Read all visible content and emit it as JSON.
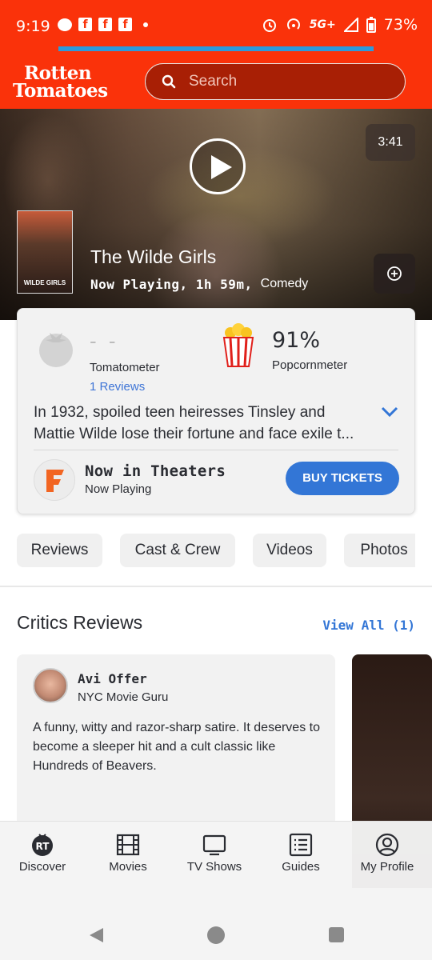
{
  "status": {
    "time": "9:19",
    "network": "5G+",
    "battery": "73%"
  },
  "header": {
    "logo_line1": "Rotten",
    "logo_line2": "Tomatoes",
    "search_placeholder": "Search"
  },
  "hero": {
    "duration": "3:41",
    "title": "The Wilde Girls",
    "status": "Now Playing, 1h 59m,",
    "genre": "Comedy",
    "poster_text": "WILDE GIRLS"
  },
  "scores": {
    "tomatometer_value": "- -",
    "tomatometer_label": "Tomatometer",
    "reviews_link": "1 Reviews",
    "popcorn_value": "91%",
    "popcorn_label": "Popcornmeter"
  },
  "synopsis": "In 1932, spoiled teen heiresses Tinsley and Mattie Wilde lose their fortune and face exile t...",
  "theaters": {
    "title": "Now in Theaters",
    "subtitle": "Now Playing",
    "button": "BUY TICKETS"
  },
  "tabs": [
    {
      "label": "Reviews"
    },
    {
      "label": "Cast & Crew"
    },
    {
      "label": "Videos"
    },
    {
      "label": "Photos"
    }
  ],
  "critics": {
    "title": "Critics Reviews",
    "view_all": "View All (1)",
    "review": {
      "name": "Avi Offer",
      "publication": "NYC Movie Guru",
      "quote": "A funny, witty and razor-sharp satire. It deserves to become a sleeper hit and a cult classic like Hundreds of Beavers."
    }
  },
  "bottom_nav": [
    {
      "label": "Discover",
      "icon": "rt-logo-icon"
    },
    {
      "label": "Movies",
      "icon": "film-icon"
    },
    {
      "label": "TV Shows",
      "icon": "tv-icon"
    },
    {
      "label": "Guides",
      "icon": "list-icon"
    },
    {
      "label": "My Profile",
      "icon": "profile-icon"
    }
  ],
  "colors": {
    "brand": "#fa320a",
    "link": "#3376d6"
  }
}
